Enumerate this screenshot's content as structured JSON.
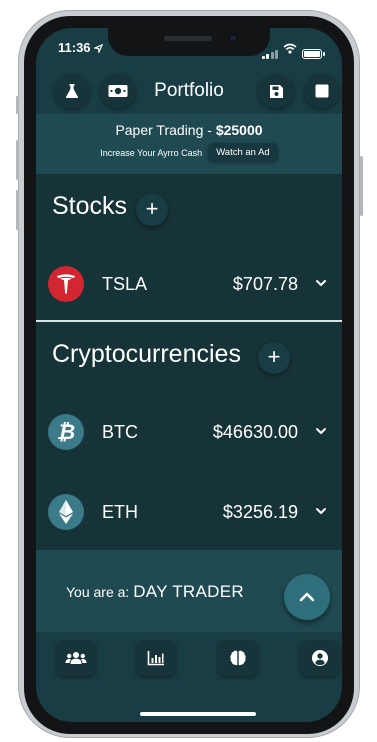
{
  "status": {
    "time": "11:36"
  },
  "header": {
    "title": "Portfolio"
  },
  "banner": {
    "label": "Paper Trading - ",
    "amount": "$25000",
    "subtext": "Increase Your Ayrro Cash",
    "watch_ad": "Watch an Ad"
  },
  "stocks": {
    "title": "Stocks",
    "add": "+",
    "items": [
      {
        "ticker": "TSLA",
        "price": "$707.78"
      }
    ]
  },
  "crypto": {
    "title": "Cryptocurrencies",
    "add": "+",
    "items": [
      {
        "ticker": "BTC",
        "price": "$46630.00"
      },
      {
        "ticker": "ETH",
        "price": "$3256.19"
      }
    ]
  },
  "trader": {
    "prefix": "You are a: ",
    "type": "DAY TRADER"
  },
  "colors": {
    "bg_dark": "#163338",
    "bg_header": "#193d44",
    "bg_banner": "#1f4a52",
    "fab": "#2f6f7c",
    "tesla_red": "#d22630",
    "crypto_icon": "#3b7a88"
  },
  "icons": {
    "header": [
      "flask-icon",
      "money-bill-icon",
      "save-icon",
      "square-icon"
    ],
    "tabs": [
      "users-icon",
      "chart-bar-icon",
      "brain-icon",
      "user-circle-icon"
    ]
  }
}
